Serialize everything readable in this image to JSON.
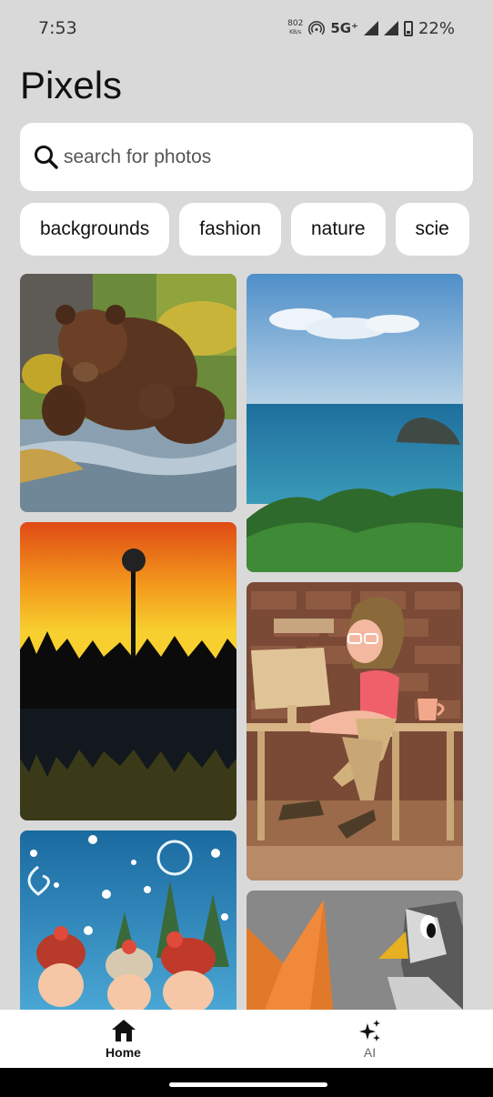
{
  "status_bar": {
    "time": "7:53",
    "speed_value": "802",
    "speed_unit": "KB/s",
    "network": "5G⁺",
    "battery": "22%"
  },
  "app": {
    "title": "Pixels"
  },
  "search": {
    "placeholder": "search for photos"
  },
  "categories": [
    "backgrounds",
    "fashion",
    "nature",
    "scie"
  ],
  "photos": [
    {
      "subject": "bear-with-cubs-in-river"
    },
    {
      "subject": "sea-island-with-trees"
    },
    {
      "subject": "sunset-dandelion-silhouette"
    },
    {
      "subject": "woman-at-computer-illustration"
    },
    {
      "subject": "christmas-kids-in-hats"
    },
    {
      "subject": "origami-bird"
    }
  ],
  "bottom_nav": {
    "home_label": "Home",
    "ai_label": "AI"
  },
  "colors": {
    "background": "#d9d9d9",
    "surface": "#ffffff",
    "text": "#111111"
  }
}
